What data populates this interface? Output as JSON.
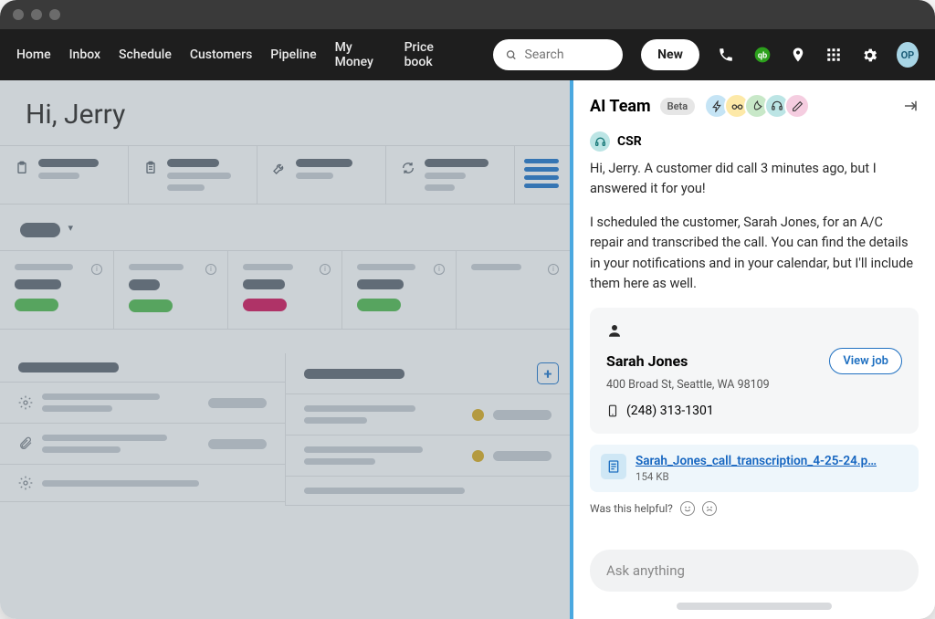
{
  "nav": {
    "items": [
      "Home",
      "Inbox",
      "Schedule",
      "Customers",
      "Pipeline",
      "My Money",
      "Price book"
    ],
    "search_placeholder": "Search",
    "new_label": "New",
    "avatar_initials": "OP"
  },
  "main": {
    "greeting": "Hi, Jerry"
  },
  "panel": {
    "title": "AI Team",
    "beta_label": "Beta",
    "agent_name": "CSR",
    "msg1": "Hi, Jerry. A customer did call 3 minutes ago, but I answered it for you!",
    "msg2": "I scheduled the customer, Sarah Jones, for an A/C repair and transcribed the call. You can find the details in your notifications and in your calendar, but I'll include them here as well.",
    "job": {
      "name": "Sarah Jones",
      "address": "400 Broad St, Seattle, WA 98109",
      "phone": "(248) 313-1301",
      "view_label": "View job"
    },
    "file": {
      "name": "Sarah_Jones_call_transcription_4-25-24.p…",
      "size": "154 KB"
    },
    "helpful_label": "Was this helpful?",
    "input_placeholder": "Ask anything"
  }
}
